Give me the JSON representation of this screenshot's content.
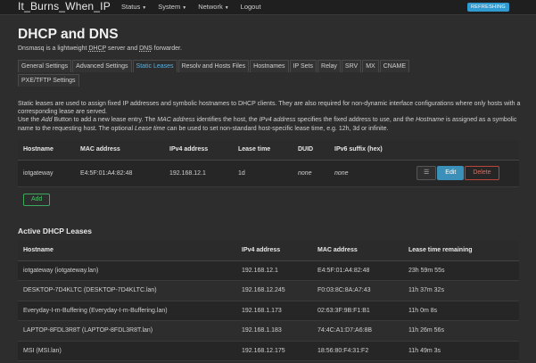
{
  "header": {
    "brand": "It_Burns_When_IP",
    "menu": [
      {
        "label": "Status",
        "icon": "caret-down"
      },
      {
        "label": "System",
        "icon": "caret-down"
      },
      {
        "label": "Network",
        "icon": "caret-down"
      },
      {
        "label": "Logout"
      }
    ],
    "badge": "REFRESHING"
  },
  "page": {
    "title": "DHCP and DNS",
    "desc_prefix": "Dnsmasq is a lightweight ",
    "desc_dhcp": "DHCP",
    "desc_middle": " server and ",
    "desc_dns": "DNS",
    "desc_suffix": " forwarder."
  },
  "tabs": [
    {
      "label": "General Settings"
    },
    {
      "label": "Advanced Settings"
    },
    {
      "label": "Static Leases",
      "active": true
    },
    {
      "label": "Resolv and Hosts Files"
    },
    {
      "label": "Hostnames"
    },
    {
      "label": "IP Sets"
    },
    {
      "label": "Relay"
    },
    {
      "label": "SRV"
    },
    {
      "label": "MX"
    },
    {
      "label": "CNAME"
    },
    {
      "label": "PXE/TFTP Settings"
    }
  ],
  "intro": {
    "line1": "Static leases are used to assign fixed IP addresses and symbolic hostnames to DHCP clients. They are also required for non-dynamic interface configurations where only hosts with a corresponding lease are served.",
    "l2_a": "Use the ",
    "l2_add": "Add",
    "l2_b": " Button to add a new lease entry. The ",
    "l2_mac": "MAC address",
    "l2_c": " identifies the host, the ",
    "l2_ipv4": "IPv4 address",
    "l2_d": " specifies the fixed address to use, and the ",
    "l2_hostname": "Hostname",
    "l2_e": " is assigned as a symbolic name to the requesting host. The optional ",
    "l2_lease": "Lease time",
    "l2_f": " can be used to set non-standard host-specific lease time, e.g. 12h, 3d or infinite."
  },
  "static_leases": {
    "columns": [
      "Hostname",
      "MAC address",
      "IPv4 address",
      "Lease time",
      "DUID",
      "IPv6 suffix (hex)"
    ],
    "rows": [
      {
        "hostname": "iotgateway",
        "mac": "E4:5F:01:A4:82:48",
        "ipv4": "192.168.12.1",
        "lease": "1d",
        "duid": "none",
        "ipv6": "none"
      }
    ],
    "menu_btn": "☰",
    "edit_btn": "Edit",
    "delete_btn": "Delete",
    "add_btn": "Add"
  },
  "active_leases": {
    "title": "Active DHCP Leases",
    "columns": [
      "Hostname",
      "IPv4 address",
      "MAC address",
      "Lease time remaining"
    ],
    "rows": [
      {
        "hostname": "iotgateway (iotgateway.lan)",
        "ipv4": "192.168.12.1",
        "mac": "E4:5F:01:A4:82:48",
        "remaining": "23h 59m 55s"
      },
      {
        "hostname": "DESKTOP-7D4KLTC (DESKTOP-7D4KLTC.lan)",
        "ipv4": "192.168.12.245",
        "mac": "F0:03:8C:8A:A7:43",
        "remaining": "11h 37m 32s"
      },
      {
        "hostname": "Everyday-I-m-Buffering (Everyday-I-m-Buffering.lan)",
        "ipv4": "192.168.1.173",
        "mac": "02:63:3F:9B:F1:B1",
        "remaining": "11h 0m 8s"
      },
      {
        "hostname": "LAPTOP-8FDL3R8T (LAPTOP-8FDL3R8T.lan)",
        "ipv4": "192.168.1.183",
        "mac": "74:4C:A1:D7:A6:8B",
        "remaining": "11h 26m 56s"
      },
      {
        "hostname": "MSI (MSI.lan)",
        "ipv4": "192.168.12.175",
        "mac": "18:56:80:F4:31:F2",
        "remaining": "11h 49m 3s"
      }
    ]
  },
  "colors": {
    "accent": "#5ab0e0",
    "badge": "#2f9bd0",
    "edit": "#3a90b8",
    "delete": "#e06a5c",
    "add": "#4cc46e"
  }
}
